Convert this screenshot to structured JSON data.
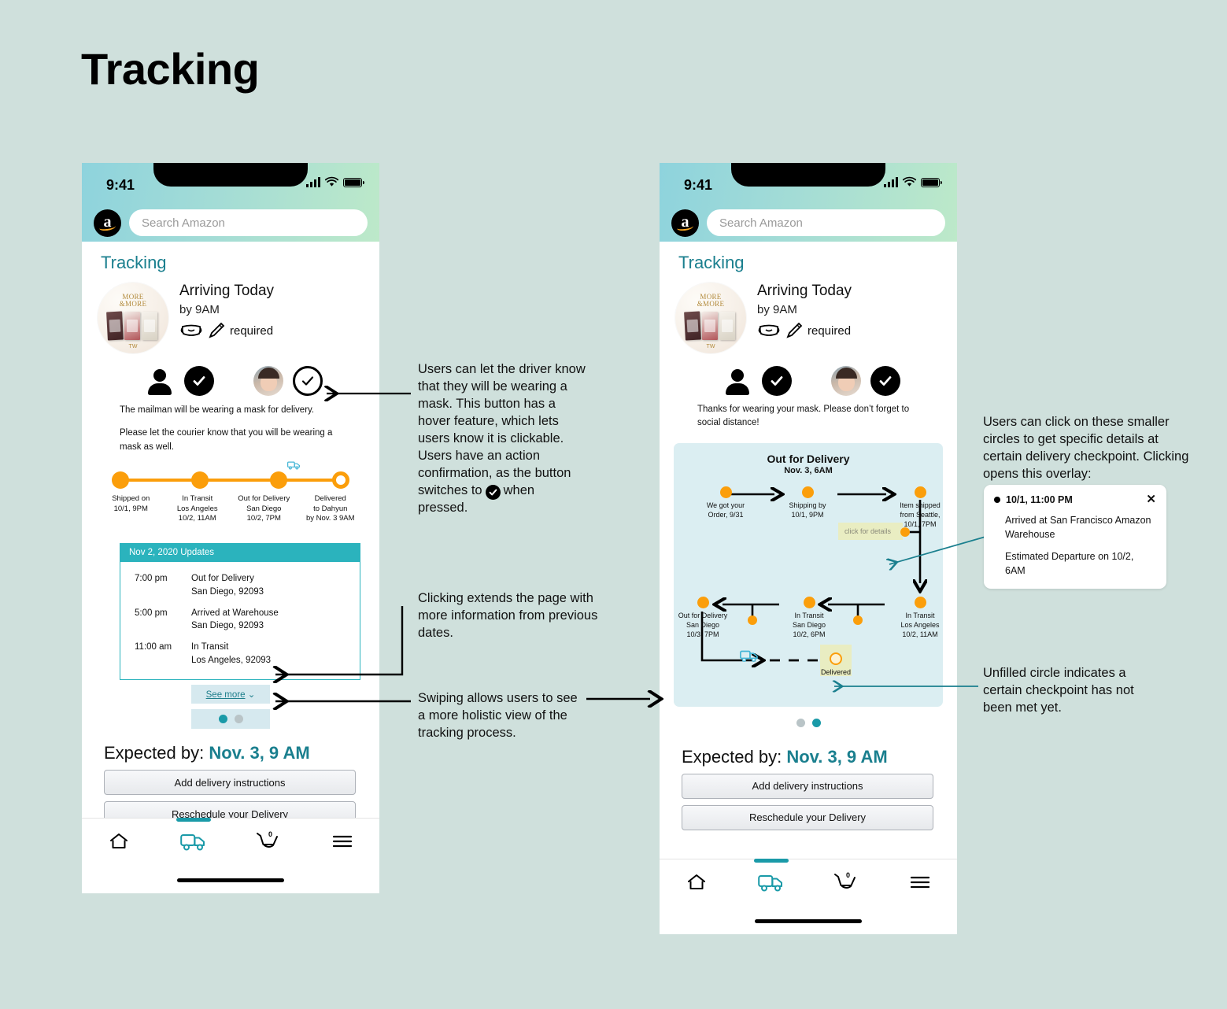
{
  "page": {
    "title": "Tracking",
    "background": "#cfe0dc"
  },
  "colors": {
    "teal": "#1a7f8e",
    "teal_bright": "#2bb3bd",
    "orange": "#fb9e0b",
    "map_bg": "#dbeef2",
    "highlight": "#e9edc2"
  },
  "phone_left": {
    "status": {
      "time": "9:41",
      "signal_icon": "cellular-bars-icon",
      "wifi_icon": "wifi-icon",
      "battery_icon": "battery-icon"
    },
    "search": {
      "logo": "amazon-logo",
      "placeholder": "Search Amazon",
      "value": ""
    },
    "screen_title": "Tracking",
    "product": {
      "image_alt": "MORE & MORE album",
      "album_title": "MORE\n&MORE",
      "album_logo": "TWICE",
      "heading": "Arriving Today",
      "subheading": "by 9AM",
      "mask_icon": "face-mask-icon",
      "pencil_icon": "pencil-icon",
      "requirement": "required"
    },
    "mask_toggle": {
      "driver_icon": "person-icon",
      "driver_state_icon": "check-filled-icon",
      "user_avatar": "user-avatar",
      "user_state_icon": "check-outline-icon"
    },
    "notes": [
      "The mailman will be wearing a mask for delivery.",
      "Please let the courier know that you will be wearing a mask as well."
    ],
    "progress": [
      {
        "status": "Shipped on",
        "line2": "10/1, 9PM",
        "line3": "",
        "filled": true
      },
      {
        "status": "In Transit",
        "line2": "Los Angeles",
        "line3": "10/2, 11AM",
        "filled": true
      },
      {
        "status": "Out for Delivery",
        "line2": "San Diego",
        "line3": "10/2, 7PM",
        "filled": true
      },
      {
        "status": "Delivered",
        "line2": "to Dahyun",
        "line3": "by Nov. 3 9AM",
        "filled": false
      }
    ],
    "truck_icon": "delivery-truck-icon",
    "updates": {
      "header": "Nov 2, 2020 Updates",
      "rows": [
        {
          "time": "7:00 pm",
          "desc": "Out for Delivery",
          "place": "San Diego, 92093"
        },
        {
          "time": "5:00 pm",
          "desc": "Arrived at Warehouse",
          "place": "San Diego, 92093"
        },
        {
          "time": "11:00 am",
          "desc": "In Transit",
          "place": "Los Angeles, 92093"
        }
      ]
    },
    "see_more": {
      "label": "See more",
      "chevron_icon": "chevron-down-icon"
    },
    "pager": {
      "active_index": 0,
      "count": 2
    },
    "expected": {
      "prefix": "Expected by:",
      "value": "Nov. 3, 9 AM"
    },
    "buttons": [
      "Add delivery instructions",
      "Reschedule your Delivery"
    ],
    "tabbar": [
      {
        "name": "home",
        "icon": "home-icon",
        "active": false
      },
      {
        "name": "orders",
        "icon": "delivery-truck-icon",
        "active": true
      },
      {
        "name": "cart",
        "icon": "shopping-cart-icon",
        "badge": "0",
        "active": false
      },
      {
        "name": "menu",
        "icon": "hamburger-menu-icon",
        "active": false
      }
    ]
  },
  "phone_right": {
    "status": {
      "time": "9:41"
    },
    "search": {
      "placeholder": "Search Amazon",
      "value": ""
    },
    "screen_title": "Tracking",
    "product": {
      "heading": "Arriving Today",
      "subheading": "by 9AM",
      "requirement": "required"
    },
    "mask_toggle": {
      "driver_state_icon": "check-filled-icon",
      "user_state_icon": "check-filled-icon"
    },
    "notes": [
      "Thanks for wearing your mask. Please don’t forget to social distance!"
    ],
    "map": {
      "title": "Out for Delivery",
      "subtitle": "Nov. 3, 6AM",
      "click_hint": "click for details",
      "nodes": [
        {
          "id": "order",
          "label": "We got your\nOrder, 9/31",
          "filled": true
        },
        {
          "id": "shipping",
          "label": "Shipping by\n10/1, 9PM",
          "filled": true
        },
        {
          "id": "seattle",
          "label": "Item shipped\nfrom Seattle,\n10/1, 7PM",
          "filled": true
        },
        {
          "id": "la",
          "label": "In Transit\nLos Angeles\n10/2, 11AM",
          "filled": true
        },
        {
          "id": "sd",
          "label": "In Transit\nSan Diego\n10/2, 6PM",
          "filled": true
        },
        {
          "id": "ofd",
          "label": "Out for Delivery\nSan Diego\n10/3, 7PM",
          "filled": true
        },
        {
          "id": "delivered",
          "label": "Delivered",
          "filled": false
        }
      ],
      "truck_icon": "delivery-truck-icon"
    },
    "pager": {
      "active_index": 1,
      "count": 2
    },
    "expected": {
      "prefix": "Expected by:",
      "value": "Nov. 3, 9 AM"
    },
    "buttons": [
      "Add delivery instructions",
      "Reschedule your Delivery"
    ]
  },
  "annotations": {
    "mask_button": "Users can let the driver know that they will be wearing a mask. This button has a hover feature, which lets users know it is clickable. Users have an action confirmation, as the button switches to",
    "mask_button_tail": "when pressed.",
    "see_more": "Clicking extends the page with more information from previous dates.",
    "swipe": "Swiping allows users to see a more holistic view of the tracking process.",
    "checkpoints": "Users can click on these smaller circles to get specific details at certain delivery checkpoint. Clicking opens this overlay:",
    "unfilled": "Unfilled circle indicates a certain checkpoint has not been met yet."
  },
  "overlay": {
    "time": "10/1, 11:00 PM",
    "close_icon": "close-icon",
    "line1": "Arrived at San Francisco Amazon Warehouse",
    "line2": "Estimated Departure on 10/2, 6AM"
  }
}
